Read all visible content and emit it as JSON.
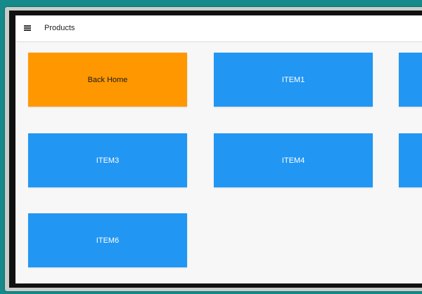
{
  "appbar": {
    "icon": "menu-icon",
    "title": "Products"
  },
  "colors": {
    "primary": "#2196f3",
    "accent": "#ff9800",
    "background": "#16898a"
  },
  "tiles": [
    {
      "label": "Back Home",
      "style": "accent"
    },
    {
      "label": "ITEM1",
      "style": "primary"
    },
    {
      "label": "",
      "style": "primary"
    },
    {
      "label": "ITEM3",
      "style": "primary"
    },
    {
      "label": "ITEM4",
      "style": "primary"
    },
    {
      "label": "",
      "style": "primary"
    },
    {
      "label": "ITEM6",
      "style": "primary"
    }
  ]
}
